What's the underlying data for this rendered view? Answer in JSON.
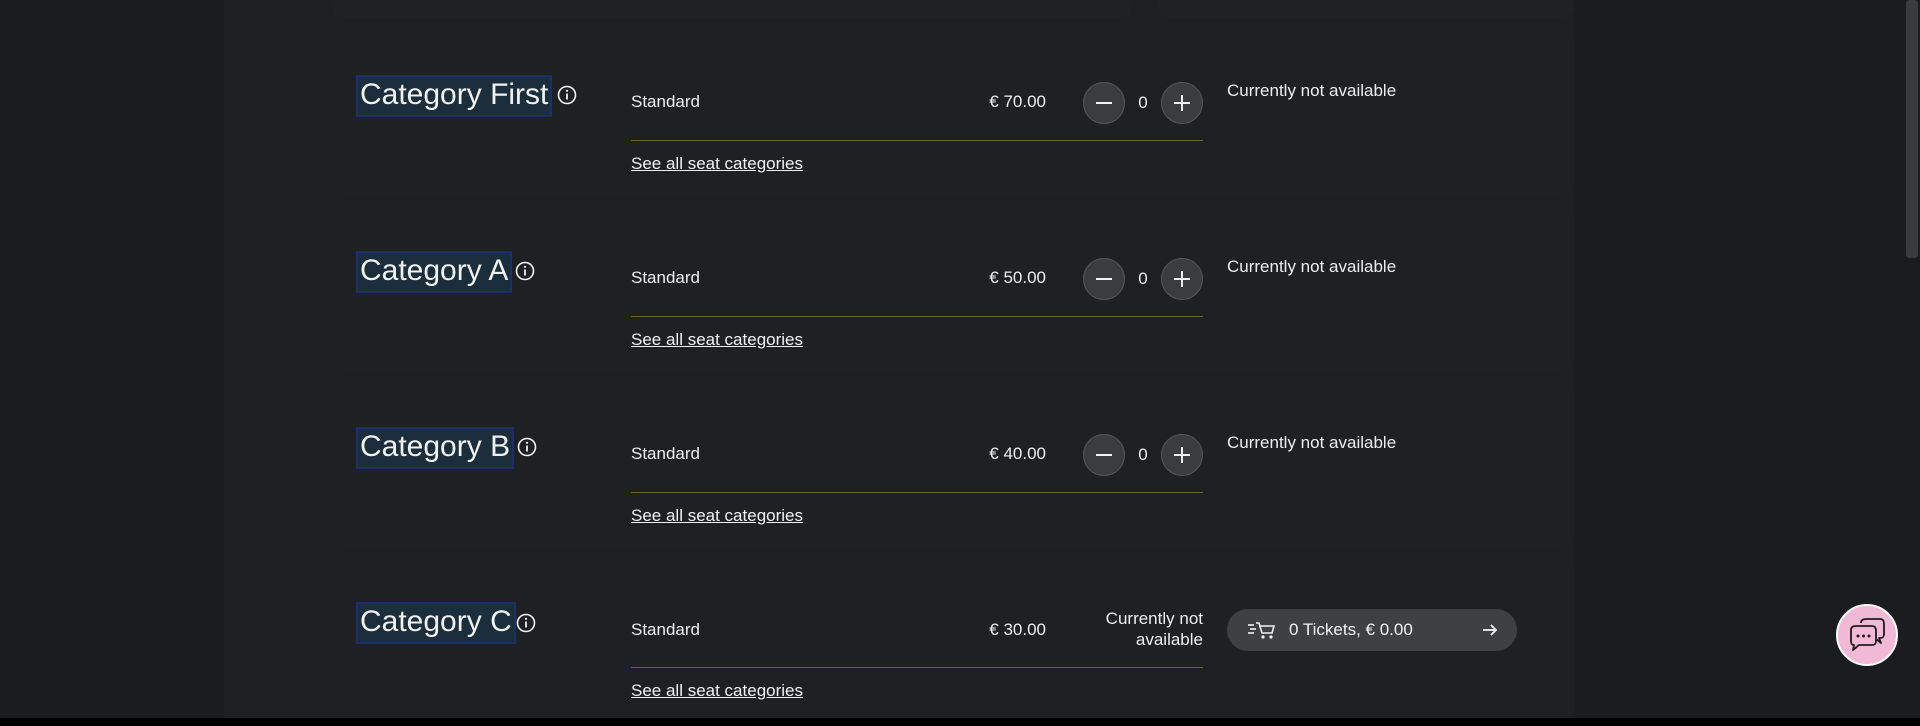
{
  "colors": {
    "background": "#1b1c1e",
    "card": "#1f2022",
    "divider_gold": "#6e6334",
    "button": "#3b3c3f",
    "chat_pink": "#f1b9d6"
  },
  "categories": [
    {
      "title": "Category First",
      "tier": "Standard",
      "price": "€ 70.00",
      "quantity": "0",
      "status": "Currently not available",
      "link": "See all seat categories"
    },
    {
      "title": "Category A",
      "tier": "Standard",
      "price": "€ 50.00",
      "quantity": "0",
      "status": "Currently not available",
      "link": "See all seat categories"
    },
    {
      "title": "Category B",
      "tier": "Standard",
      "price": "€ 40.00",
      "quantity": "0",
      "status": "Currently not available",
      "link": "See all seat categories"
    },
    {
      "title": "Category C",
      "tier": "Standard",
      "price": "€ 30.00",
      "status_line1": "Currently not",
      "status_line2": "available",
      "link": "See all seat categories"
    }
  ],
  "cart": {
    "label": "0 Tickets, € 0.00",
    "icon": "cart-speed-icon",
    "arrow_icon": "arrow-right-icon"
  },
  "chat": {
    "icon": "chat-bubbles-icon"
  }
}
